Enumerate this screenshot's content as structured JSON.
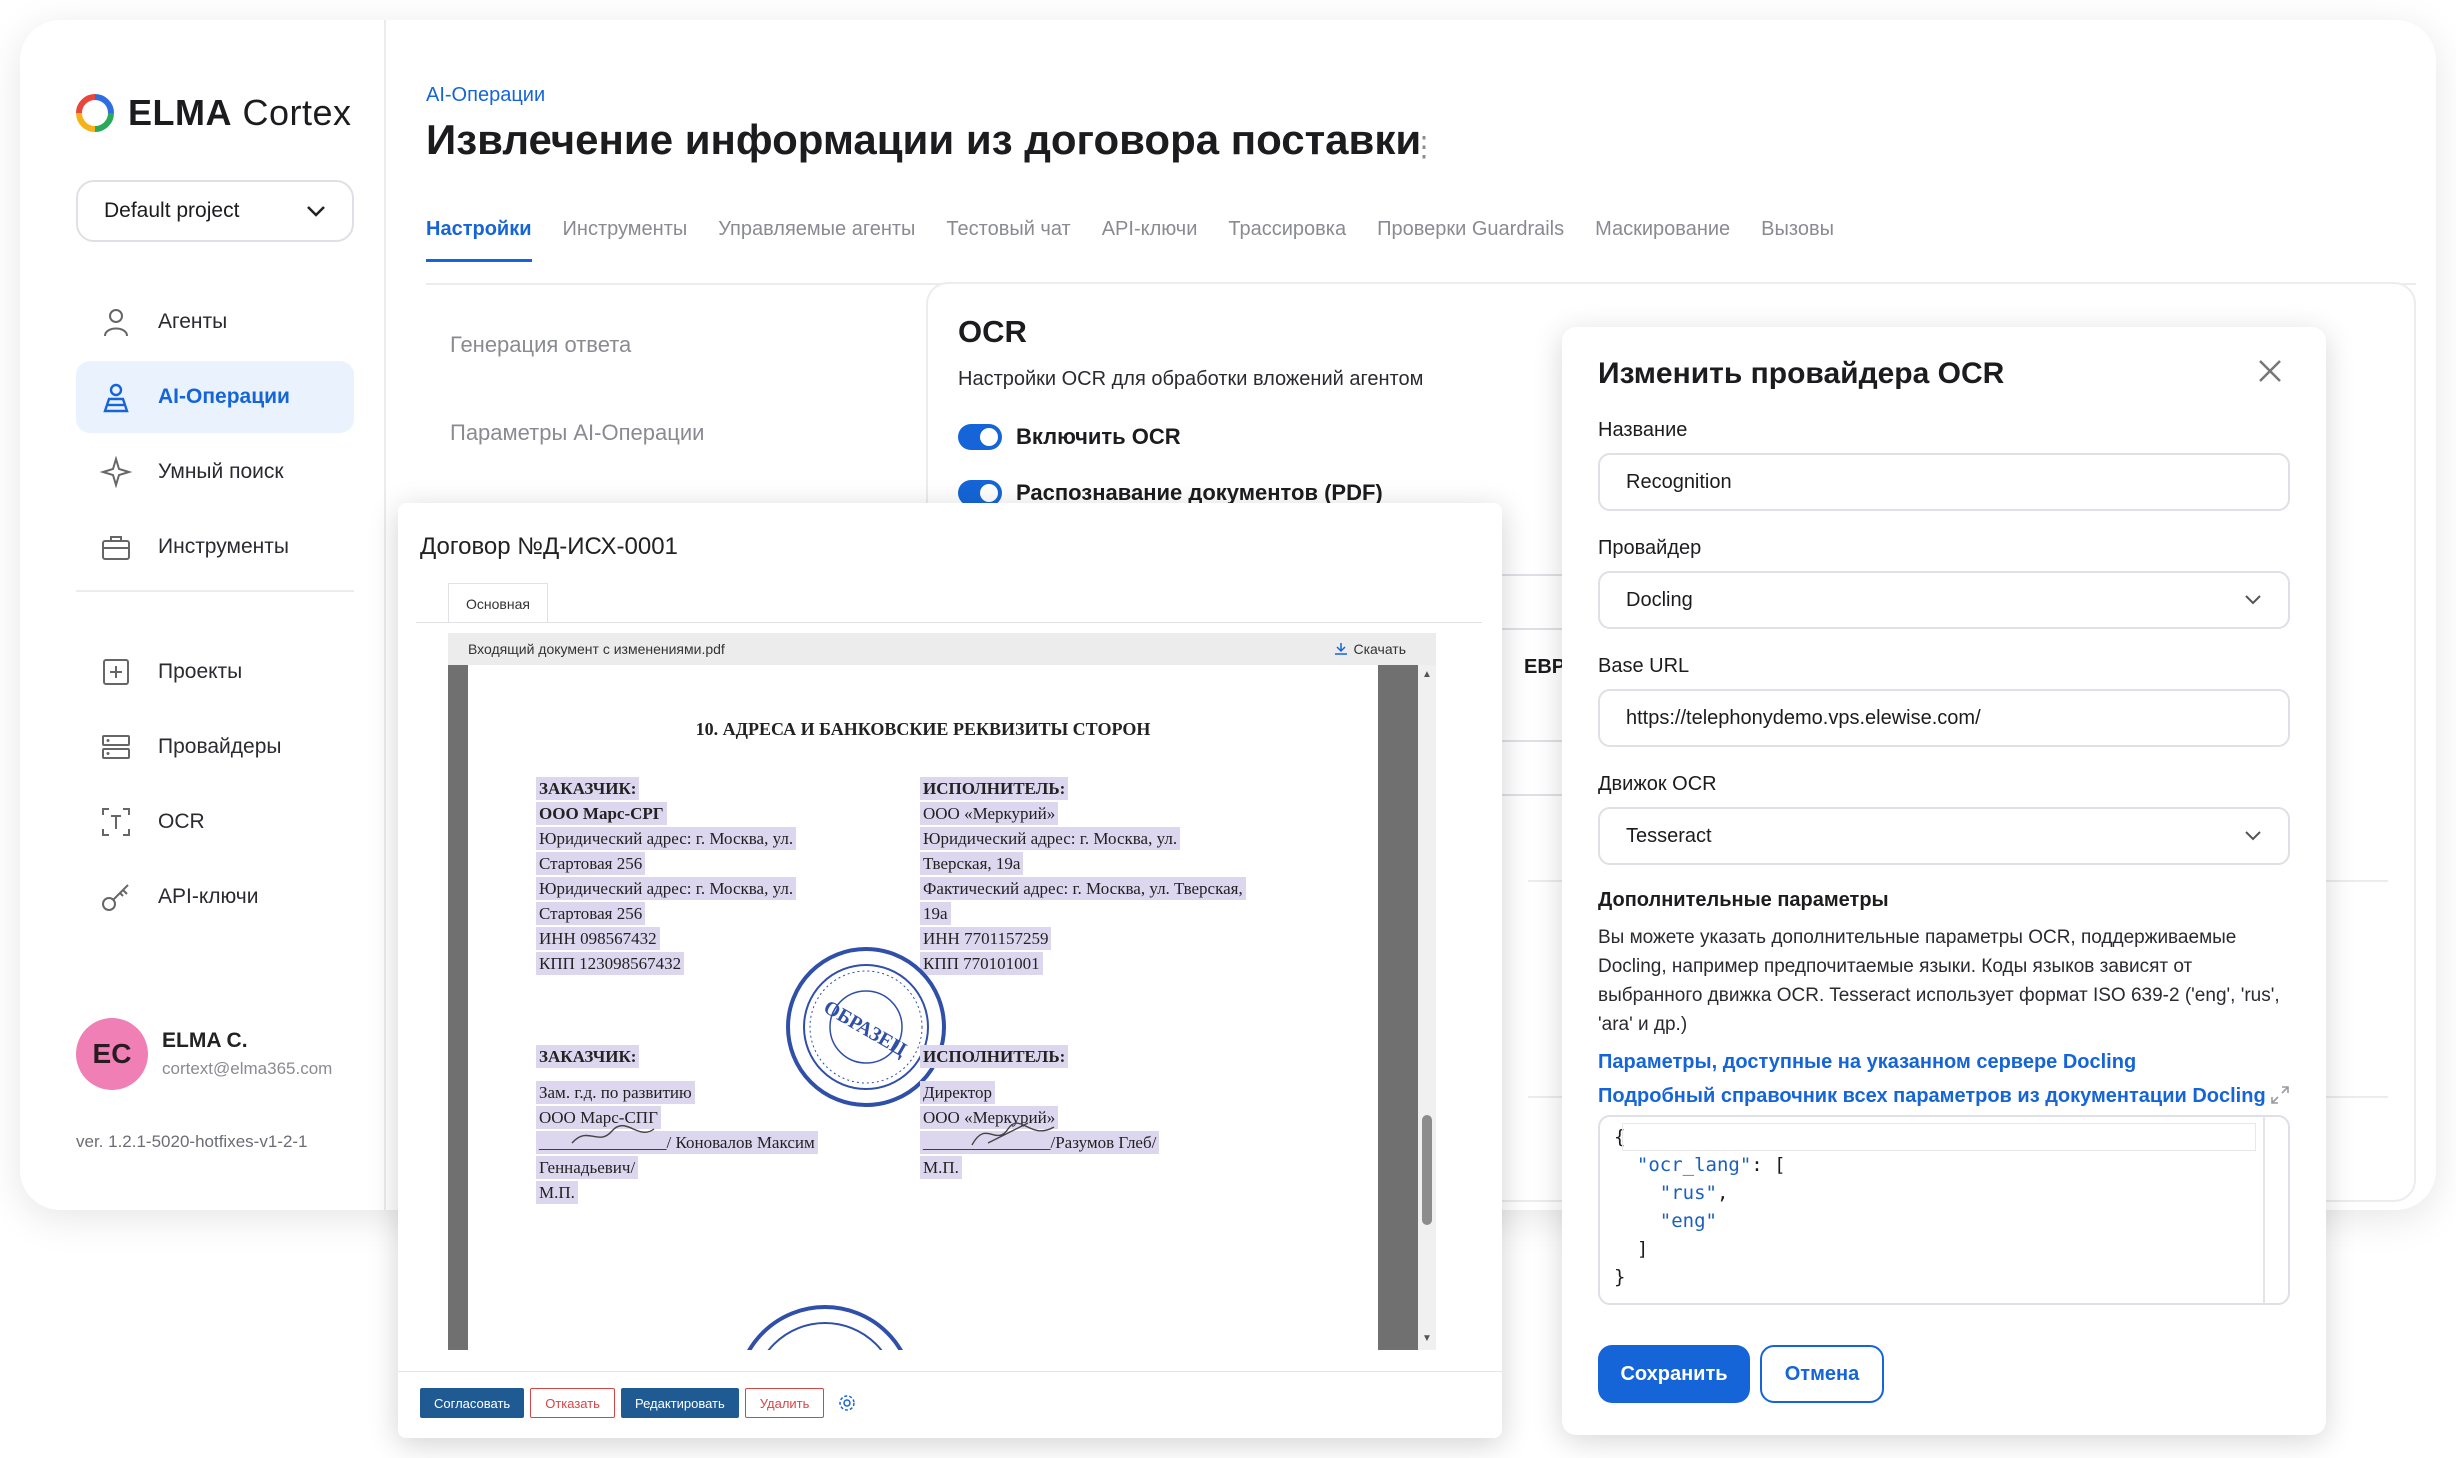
{
  "app": {
    "logo_text_bold": "ELMA",
    "logo_text": "Cortex",
    "project": "Default project",
    "nav_main": [
      {
        "label": "Агенты",
        "icon": "agent-icon"
      },
      {
        "label": "AI-Операции",
        "icon": "ai-ops-icon",
        "active": true
      },
      {
        "label": "Умный поиск",
        "icon": "smart-search-icon"
      },
      {
        "label": "Инструменты",
        "icon": "toolbox-icon"
      }
    ],
    "nav_secondary": [
      {
        "label": "Проекты",
        "icon": "projects-icon"
      },
      {
        "label": "Провайдеры",
        "icon": "providers-icon"
      },
      {
        "label": "OCR",
        "icon": "ocr-icon"
      },
      {
        "label": "API-ключи",
        "icon": "key-icon"
      }
    ],
    "user": {
      "initials": "EC",
      "name": "ELMA C.",
      "email": "cortext@elma365.com"
    },
    "version": "ver. 1.2.1-5020-hotfixes-v1-2-1"
  },
  "header": {
    "breadcrumb": "AI-Операции",
    "title": "Извлечение информации из договора поставки",
    "tabs": [
      "Настройки",
      "Инструменты",
      "Управляемые агенты",
      "Тестовый чат",
      "API-ключи",
      "Трассировка",
      "Проверки Guardrails",
      "Маскирование",
      "Вызовы"
    ]
  },
  "settings": {
    "subnav": [
      "Генерация ответа",
      "Параметры AI-Операции"
    ],
    "ocr_title": "OCR",
    "ocr_subtitle": "Настройки OCR для обработки вложений агентом",
    "toggles": [
      {
        "label": "Включить OCR",
        "on": true
      },
      {
        "label": "Распознавание документов (PDF)",
        "on": true
      }
    ],
    "partial_text": "ЕВР и д"
  },
  "document": {
    "title": "Договор №Д-ИСХ-0001",
    "tab": "Основная",
    "file_name": "Входящий документ с изменениями.pdf",
    "download_label": "Скачать",
    "page": {
      "heading": "10. АДРЕСА И БАНКОВСКИЕ РЕКВИЗИТЫ СТОРОН",
      "left_block": [
        "ЗАКАЗЧИК:",
        "ООО Марс-СРГ",
        "Юридический адрес: г. Москва, ул.",
        "Стартовая 256",
        "Юридический адрес: г. Москва, ул.",
        "Стартовая 256",
        "ИНН 098567432",
        "КПП 123098567432"
      ],
      "right_block": [
        "ИСПОЛНИТЕЛЬ:",
        "ООО «Меркурий»",
        "Юридический адрес: г. Москва, ул.",
        "Тверская, 19а",
        "Фактический адрес: г. Москва, ул. Тверская,",
        "19а",
        "ИНН  7701157259",
        "КПП  770101001"
      ],
      "left_sign": [
        "ЗАКАЗЧИК:",
        "Зам. г.д. по развитию",
        "ООО Марс-СПГ",
        "_______________/ Коновалов Максим",
        "Геннадьевич/",
        "М.П."
      ],
      "right_sign": [
        "ИСПОЛНИТЕЛЬ:",
        "Директор",
        "ООО «Меркурий»",
        "_______________/Разумов Глеб/",
        "М.П."
      ],
      "stamp_text": "ОБРАЗЕЦ"
    },
    "actions": [
      "Согласовать",
      "Отказать",
      "Редактировать",
      "Удалить"
    ]
  },
  "dialog": {
    "title": "Изменить провайдера OCR",
    "fields": [
      {
        "label": "Название",
        "value": "Recognition",
        "type": "input"
      },
      {
        "label": "Провайдер",
        "value": "Docling",
        "type": "select"
      },
      {
        "label": "Base URL",
        "value": "https://telephonydemo.vps.elewise.com/",
        "type": "input"
      },
      {
        "label": "Движок OCR",
        "value": "Tesseract",
        "type": "select"
      }
    ],
    "extra_heading": "Дополнительные параметры",
    "extra_text": "Вы можете указать дополнительные параметры OCR, поддерживаемые Docling, например предпочитаемые языки. Коды языков зависят от выбранного движка OCR. Tesseract использует формат ISO 639-2 ('eng', 'rus', 'ara' и др.)",
    "link1": "Параметры, доступные на указанном сервере Docling",
    "link2": "Подробный справочник всех параметров из документации Docling",
    "code": {
      "key": "\"ocr_lang\"",
      "values": [
        "\"rus\"",
        "\"eng\""
      ]
    },
    "save_label": "Сохранить",
    "cancel_label": "Отмена"
  },
  "colors": {
    "accent": "#1565d8",
    "active_bg": "#eaf2fe",
    "highlight": "#dcd7ef",
    "avatar": "#ef7fb4",
    "doc_button": "#1f5a93",
    "danger": "#d84545"
  }
}
